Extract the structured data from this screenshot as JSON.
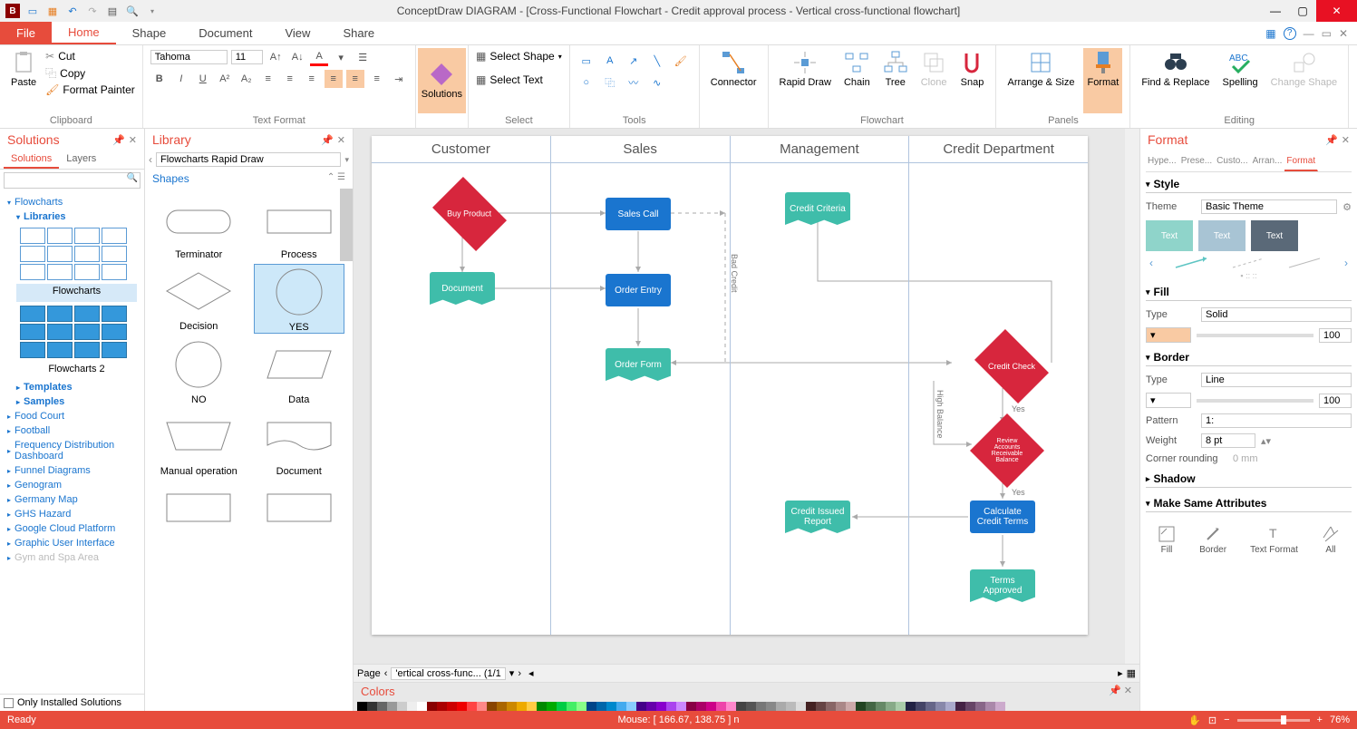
{
  "title": "ConceptDraw DIAGRAM - [Cross-Functional Flowchart - Credit approval process - Vertical cross-functional flowchart]",
  "menu": {
    "file": "File",
    "tabs": [
      "Home",
      "Shape",
      "Document",
      "View",
      "Share"
    ],
    "active": 0
  },
  "ribbon": {
    "clipboard": {
      "paste": "Paste",
      "cut": "Cut",
      "copy": "Copy",
      "painter": "Format Painter",
      "label": "Clipboard"
    },
    "text": {
      "font": "Tahoma",
      "size": "11",
      "label": "Text Format"
    },
    "solutions": {
      "label": "Solutions"
    },
    "select": {
      "shape": "Select Shape",
      "text": "Select Text",
      "label": "Select"
    },
    "tools": {
      "label": "Tools"
    },
    "connector": {
      "label": "Connector"
    },
    "flowchart": {
      "rapid": "Rapid Draw",
      "chain": "Chain",
      "tree": "Tree",
      "clone": "Clone",
      "snap": "Snap",
      "label": "Flowchart"
    },
    "panels": {
      "arrange": "Arrange & Size",
      "format": "Format",
      "label": "Panels"
    },
    "editing": {
      "find": "Find & Replace",
      "spelling": "Spelling",
      "change": "Change Shape",
      "label": "Editing"
    }
  },
  "solutions": {
    "title": "Solutions",
    "tabs": [
      "Solutions",
      "Layers"
    ],
    "tree": {
      "flowcharts": "Flowcharts",
      "libraries": "Libraries",
      "flowcharts_lib": "Flowcharts",
      "flowcharts2_lib": "Flowcharts 2",
      "templates": "Templates",
      "samples": "Samples",
      "items": [
        "Food Court",
        "Football",
        "Frequency Distribution Dashboard",
        "Funnel Diagrams",
        "Genogram",
        "Germany Map",
        "GHS Hazard",
        "Google Cloud Platform",
        "Graphic User Interface",
        "Gym and Spa Area"
      ]
    },
    "only_installed": "Only Installed Solutions"
  },
  "library": {
    "title": "Library",
    "select": "Flowcharts Rapid Draw",
    "shapes_header": "Shapes",
    "shapes": [
      "Terminator",
      "Process",
      "Decision",
      "YES",
      "NO",
      "Data",
      "Manual operation",
      "Document"
    ]
  },
  "canvas": {
    "lanes": [
      "Customer",
      "Sales",
      "Management",
      "Credit Department"
    ],
    "nodes": {
      "buy": "Buy Product",
      "doc": "Document",
      "sales_call": "Sales Call",
      "order_entry": "Order Entry",
      "order_form": "Order Form",
      "criteria": "Credit Criteria",
      "check": "Credit Check",
      "review": "Review Accounts Receivable Balance",
      "calc": "Calculate Credit Terms",
      "approved": "Terms Approved",
      "report": "Credit Issued Report"
    },
    "labels": {
      "bad": "Bad Credit",
      "high": "High Balance",
      "yes1": "Yes",
      "yes2": "Yes"
    },
    "page_label": "Page",
    "page_tab": "'ertical cross-func... (1/1"
  },
  "colors": {
    "title": "Colors"
  },
  "format": {
    "title": "Format",
    "tabs": [
      "Hype...",
      "Prese...",
      "Custo...",
      "Arran...",
      "Format"
    ],
    "style": {
      "header": "Style",
      "theme_label": "Theme",
      "theme_value": "Basic Theme",
      "previews": [
        "Text",
        "Text",
        "Text"
      ]
    },
    "fill": {
      "header": "Fill",
      "type_label": "Type",
      "type_value": "Solid",
      "opacity": "100"
    },
    "border": {
      "header": "Border",
      "type_label": "Type",
      "type_value": "Line",
      "opacity": "100",
      "pattern_label": "Pattern",
      "pattern_value": "1:",
      "weight_label": "Weight",
      "weight_value": "8 pt",
      "corner_label": "Corner rounding",
      "corner_value": "0 mm"
    },
    "shadow": {
      "header": "Shadow"
    },
    "same": {
      "header": "Make Same Attributes",
      "icons": [
        "Fill",
        "Border",
        "Text Format",
        "All"
      ]
    }
  },
  "status": {
    "ready": "Ready",
    "mouse": "Mouse: [ 166.67, 138.75 ] n",
    "zoom": "76%"
  }
}
